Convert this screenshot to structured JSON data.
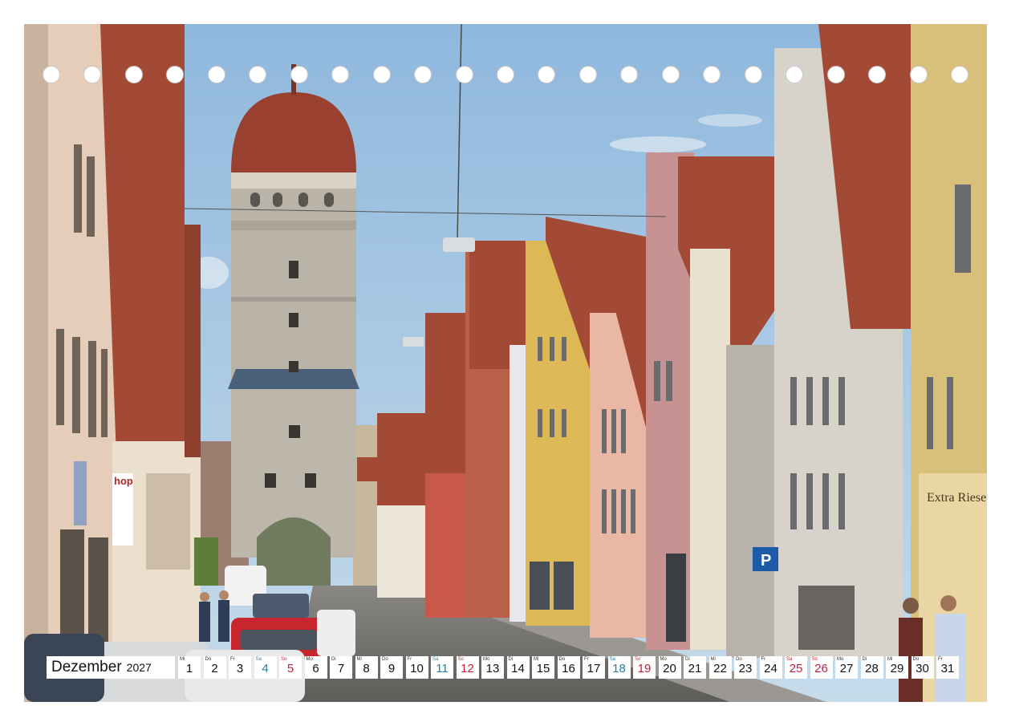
{
  "calendar": {
    "month": "Dezember",
    "year": "2027",
    "days": [
      {
        "wd": "Mi",
        "n": "1",
        "kind": "normal"
      },
      {
        "wd": "Do",
        "n": "2",
        "kind": "normal"
      },
      {
        "wd": "Fr",
        "n": "3",
        "kind": "normal"
      },
      {
        "wd": "Sa",
        "n": "4",
        "kind": "sat"
      },
      {
        "wd": "So",
        "n": "5",
        "kind": "sun"
      },
      {
        "wd": "Mo",
        "n": "6",
        "kind": "normal"
      },
      {
        "wd": "Di",
        "n": "7",
        "kind": "normal"
      },
      {
        "wd": "Mi",
        "n": "8",
        "kind": "normal"
      },
      {
        "wd": "Do",
        "n": "9",
        "kind": "normal"
      },
      {
        "wd": "Fr",
        "n": "10",
        "kind": "normal"
      },
      {
        "wd": "Sa",
        "n": "11",
        "kind": "sat"
      },
      {
        "wd": "So",
        "n": "12",
        "kind": "sun"
      },
      {
        "wd": "Mo",
        "n": "13",
        "kind": "normal"
      },
      {
        "wd": "Di",
        "n": "14",
        "kind": "normal"
      },
      {
        "wd": "Mi",
        "n": "15",
        "kind": "normal"
      },
      {
        "wd": "Do",
        "n": "16",
        "kind": "normal"
      },
      {
        "wd": "Fr",
        "n": "17",
        "kind": "normal"
      },
      {
        "wd": "Sa",
        "n": "18",
        "kind": "sat"
      },
      {
        "wd": "So",
        "n": "19",
        "kind": "sun"
      },
      {
        "wd": "Mo",
        "n": "20",
        "kind": "normal"
      },
      {
        "wd": "Di",
        "n": "21",
        "kind": "normal"
      },
      {
        "wd": "Mi",
        "n": "22",
        "kind": "normal"
      },
      {
        "wd": "Do",
        "n": "23",
        "kind": "normal"
      },
      {
        "wd": "Fr",
        "n": "24",
        "kind": "normal"
      },
      {
        "wd": "Sa",
        "n": "25",
        "kind": "hol"
      },
      {
        "wd": "So",
        "n": "26",
        "kind": "sun"
      },
      {
        "wd": "Mo",
        "n": "27",
        "kind": "normal"
      },
      {
        "wd": "Di",
        "n": "28",
        "kind": "normal"
      },
      {
        "wd": "Mi",
        "n": "29",
        "kind": "normal"
      },
      {
        "wd": "Do",
        "n": "30",
        "kind": "normal"
      },
      {
        "wd": "Fr",
        "n": "31",
        "kind": "normal"
      }
    ]
  },
  "photo": {
    "shop_sign_left": "hop",
    "shop_sign_right": "Extra Rieser Nach",
    "parking_sign": "P"
  },
  "colors": {
    "sky": "#9fc3e3",
    "roof": "#a24a35",
    "tower_stone": "#b9b3a8",
    "dome": "#9a4030",
    "saturday": "#2a7fa0",
    "sunday": "#c0203a"
  }
}
